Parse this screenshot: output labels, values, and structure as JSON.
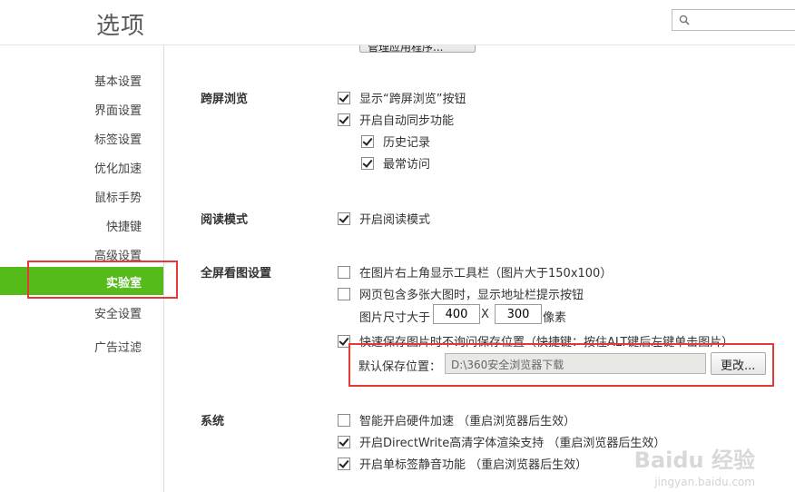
{
  "header": {
    "title": "选项",
    "search_placeholder": ""
  },
  "sidebar": {
    "items": [
      {
        "label": "基本设置"
      },
      {
        "label": "界面设置"
      },
      {
        "label": "标签设置"
      },
      {
        "label": "优化加速"
      },
      {
        "label": "鼠标手势"
      },
      {
        "label": "快捷键"
      },
      {
        "label": "高级设置"
      },
      {
        "label": "实验室",
        "active": true
      },
      {
        "label": "安全设置"
      },
      {
        "label": "广告过滤"
      }
    ],
    "active_color": "#54bb1b"
  },
  "top_partial_button": "管理应用程序...",
  "sections": {
    "cross_screen": {
      "title": "跨屏浏览",
      "options": [
        {
          "label": "显示“跨屏浏览”按钮",
          "checked": true
        },
        {
          "label": "开启自动同步功能",
          "checked": true
        },
        {
          "label": "历史记录",
          "checked": true
        },
        {
          "label": "最常访问",
          "checked": true
        }
      ]
    },
    "reading_mode": {
      "title": "阅读模式",
      "options": [
        {
          "label": "开启阅读模式",
          "checked": true
        }
      ]
    },
    "fullscreen_image": {
      "title": "全屏看图设置",
      "options": [
        {
          "label": "在图片右上角显示工具栏（图片大于150x100）",
          "checked": false
        },
        {
          "label": "网页包含多张大图时，显示地址栏提示按钮",
          "checked": false
        },
        {
          "label": "快速保存图片时不询问保存位置（快捷键：按住ALT键后左键单击图片）",
          "checked": true
        }
      ],
      "size_label": "图片尺寸大于",
      "size_width": "400",
      "size_x": "X",
      "size_height": "300",
      "size_unit": "像素",
      "save_location_label": "默认保存位置：",
      "save_location_value": "D:\\360安全浏览器下载",
      "change_button": "更改..."
    },
    "system": {
      "title": "系统",
      "options": [
        {
          "label": "智能开启硬件加速 （重启浏览器后生效）",
          "checked": false
        },
        {
          "label": "开启DirectWrite高清字体渲染支持 （重启浏览器后生效）",
          "checked": true
        },
        {
          "label": "开启单标签静音功能 （重启浏览器后生效）",
          "checked": true
        }
      ]
    }
  },
  "watermark": {
    "main": "Baidu 经验",
    "sub": "jingyan.baidu.com"
  },
  "highlight_color": "#e53935"
}
